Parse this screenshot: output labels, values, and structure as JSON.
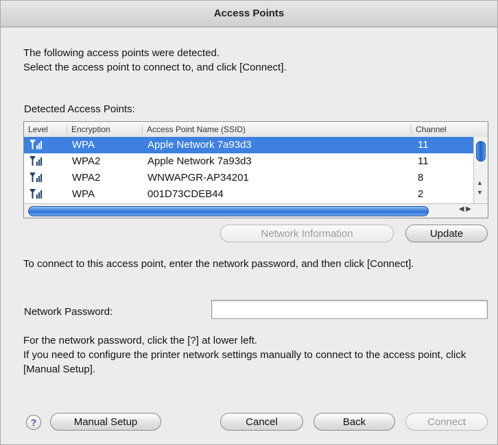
{
  "window": {
    "title": "Access Points"
  },
  "intro": {
    "line1": "The following access points were detected.",
    "line2": "Select the access point to connect to, and click [Connect]."
  },
  "list": {
    "label": "Detected Access Points:",
    "columns": [
      "Level",
      "Encryption",
      "Access Point Name (SSID)",
      "Channel"
    ],
    "rows": [
      {
        "level_icon": "signal-strength-icon",
        "encryption": "WPA",
        "ssid": "Apple Network 7a93d3",
        "channel": "11",
        "selected": true
      },
      {
        "level_icon": "signal-strength-icon",
        "encryption": "WPA2",
        "ssid": "Apple Network 7a93d3",
        "channel": "11",
        "selected": false
      },
      {
        "level_icon": "signal-strength-icon",
        "encryption": "WPA2",
        "ssid": "WNWAPGR-AP34201",
        "channel": "8",
        "selected": false
      },
      {
        "level_icon": "signal-strength-icon",
        "encryption": "WPA",
        "ssid": "001D73CDEB44",
        "channel": "2",
        "selected": false
      }
    ]
  },
  "buttons": {
    "network_info": "Network Information",
    "update": "Update",
    "manual_setup": "Manual Setup",
    "cancel": "Cancel",
    "back": "Back",
    "connect": "Connect",
    "help": "?"
  },
  "password": {
    "instruction": "To connect to this access point, enter the network password, and then click [Connect].",
    "label": "Network Password:",
    "value": ""
  },
  "notes": {
    "line1": "For the network password, click the [?] at lower left.",
    "line2": "If you need to configure the printer network settings manually to connect to the access point, click [Manual Setup]."
  },
  "colors": {
    "selection": "#3d80df",
    "accent": "#2f72d6",
    "help_mark": "#6a3fb0"
  }
}
